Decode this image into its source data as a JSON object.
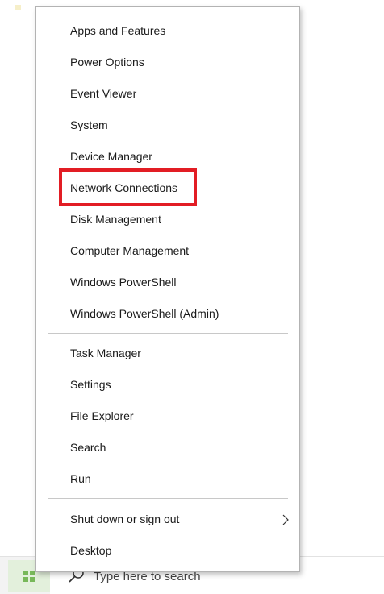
{
  "menu": {
    "group1": [
      {
        "label": "Apps and Features"
      },
      {
        "label": "Power Options"
      },
      {
        "label": "Event Viewer"
      },
      {
        "label": "System"
      },
      {
        "label": "Device Manager"
      },
      {
        "label": "Network Connections",
        "highlighted": true
      },
      {
        "label": "Disk Management"
      },
      {
        "label": "Computer Management"
      },
      {
        "label": "Windows PowerShell"
      },
      {
        "label": "Windows PowerShell (Admin)"
      }
    ],
    "group2": [
      {
        "label": "Task Manager"
      },
      {
        "label": "Settings"
      },
      {
        "label": "File Explorer"
      },
      {
        "label": "Search"
      },
      {
        "label": "Run"
      }
    ],
    "group3": [
      {
        "label": "Shut down or sign out",
        "has_submenu": true,
        "icon": "chevron-right-icon"
      },
      {
        "label": "Desktop"
      }
    ],
    "highlight_color": "#e21d24"
  },
  "taskbar": {
    "start_icon": "windows-logo-icon",
    "search_icon": "search-icon",
    "search_placeholder": "Type here to search"
  }
}
